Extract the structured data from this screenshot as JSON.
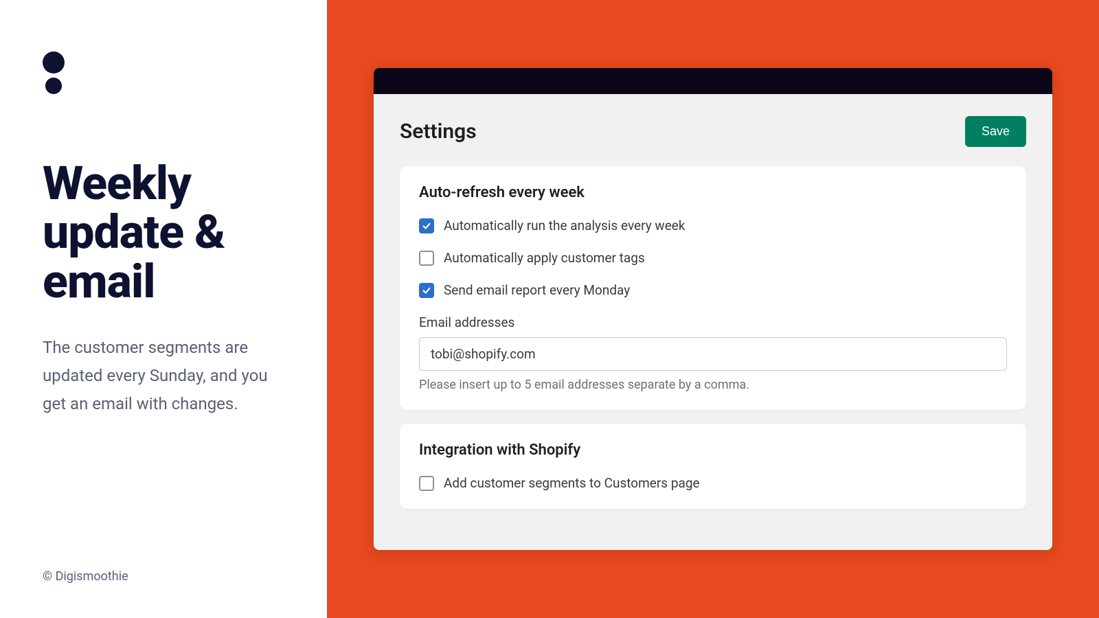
{
  "left": {
    "headline": "Weekly update & email",
    "description": "The customer segments are updated every Sunday, and you get an email with changes.",
    "copyright": "© Digismoothie"
  },
  "settings": {
    "page_title": "Settings",
    "save_label": "Save",
    "auto_refresh": {
      "title": "Auto-refresh every week",
      "checkboxes": [
        {
          "label": "Automatically run the analysis every week",
          "checked": true
        },
        {
          "label": "Automatically apply customer tags",
          "checked": false
        },
        {
          "label": "Send email report every Monday",
          "checked": true
        }
      ],
      "email_field_label": "Email addresses",
      "email_value": "tobi@shopify.com",
      "email_helper": "Please insert up to 5 email addresses separate by a comma."
    },
    "integration": {
      "title": "Integration with Shopify",
      "checkboxes": [
        {
          "label": "Add customer segments to Customers page",
          "checked": false
        }
      ]
    }
  },
  "colors": {
    "accent_orange": "#e8491e",
    "save_green": "#008060",
    "checkbox_blue": "#2c6ecb",
    "dark_navy": "#0c1230"
  }
}
